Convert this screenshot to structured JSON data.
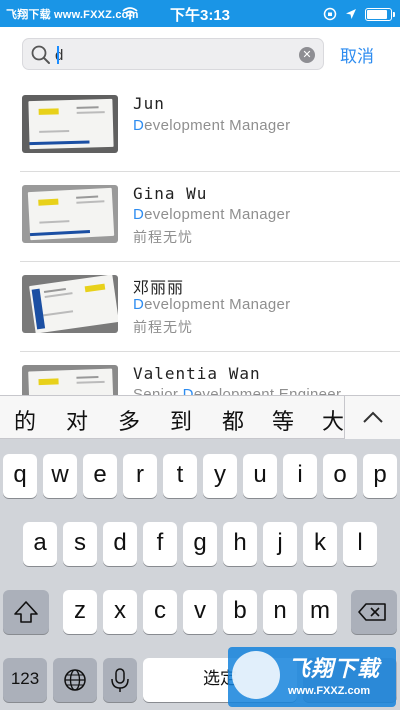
{
  "status_bar": {
    "watermark": "飞翔下载 www.FXXZ.com",
    "time": "下午3:13",
    "bg_color": "#1a95e6"
  },
  "search": {
    "value": "d",
    "placeholder": "",
    "cancel_label": "取消"
  },
  "results": [
    {
      "name": "Jun",
      "title_highlight": "D",
      "title_rest": "evelopment Manager",
      "company": ""
    },
    {
      "name": "Gina Wu",
      "title_highlight": "D",
      "title_rest": "evelopment Manager",
      "company": "前程无忧"
    },
    {
      "name": "邓丽丽",
      "title_highlight": "D",
      "title_rest": "evelopment Manager",
      "company": "前程无忧"
    },
    {
      "name": "Valentia Wan",
      "title_prefix": "Senior ",
      "title_highlight": "D",
      "title_rest": "evelopment Engineer",
      "company": ""
    }
  ],
  "keyboard": {
    "candidates": [
      "的",
      "对",
      "多",
      "到",
      "都",
      "等",
      "大"
    ],
    "row1": [
      "q",
      "w",
      "e",
      "r",
      "t",
      "y",
      "u",
      "i",
      "o",
      "p"
    ],
    "row2": [
      "a",
      "s",
      "d",
      "f",
      "g",
      "h",
      "j",
      "k",
      "l"
    ],
    "row3": [
      "z",
      "x",
      "c",
      "v",
      "b",
      "n",
      "m"
    ],
    "numbers_label": "123",
    "space_label": "选定"
  },
  "watermark_logo": {
    "text": "飞翔下载",
    "url": "www.FXXZ.com"
  },
  "colors": {
    "accent": "#2d8cf0",
    "highlight": "#2d8cf0"
  }
}
